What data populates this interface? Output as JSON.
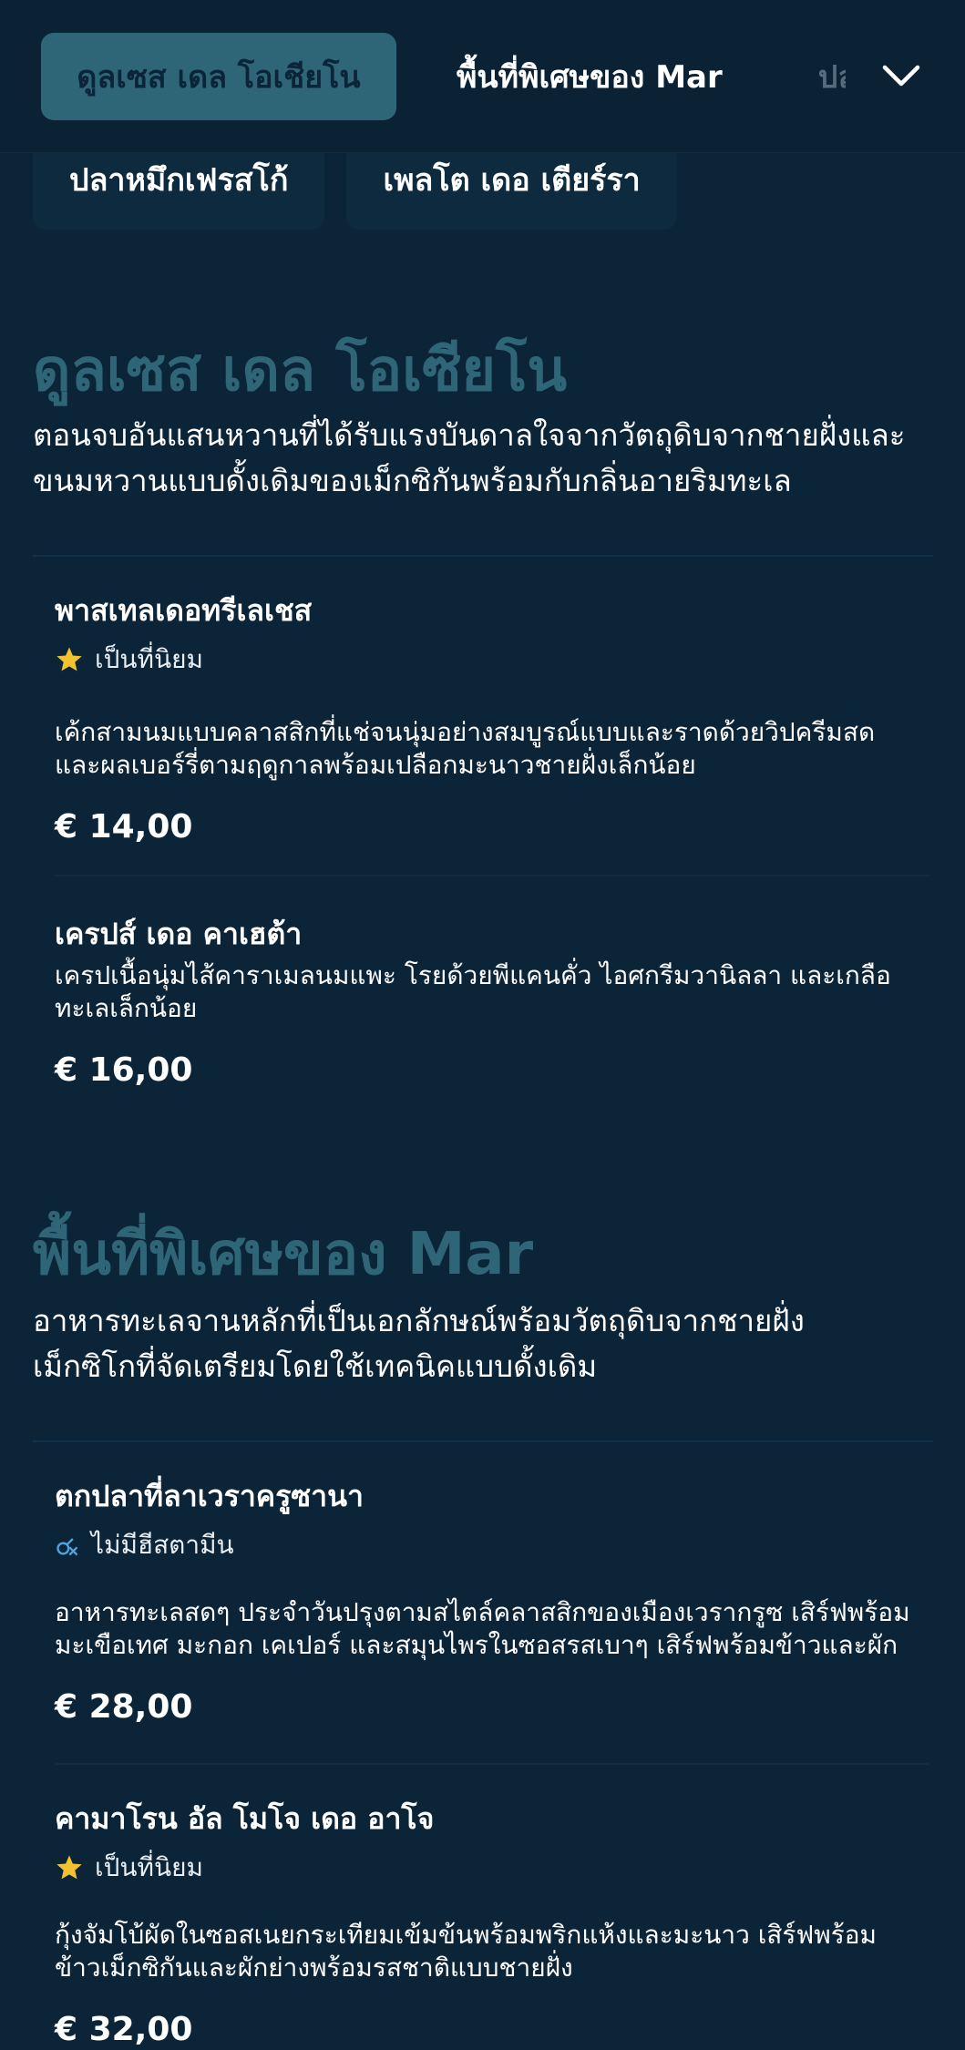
{
  "tabs": [
    {
      "label": "ดูลเซส เดล โอเชียโน",
      "active": true
    },
    {
      "label": "พื้นที่พิเศษของ Mar",
      "active": false
    },
    {
      "label": "ปล",
      "active": false
    }
  ],
  "subtabs": [
    {
      "label": "ปลาหมึกเฟรสโก้"
    },
    {
      "label": "เพลโต เดอ เตียร์รา"
    }
  ],
  "sections": [
    {
      "title": "ดูลเซส เดล โอเซียโน",
      "description": "ตอนจบอันแสนหวานที่ได้รับแรงบันดาลใจจากวัตถุดิบจากชายฝั่งและขนมหวานแบบดั้งเดิมของเม็กซิกันพร้อมกับกลิ่นอายริมทะเล",
      "items": [
        {
          "name": "พาสเทลเดอทรีเลเชส",
          "badge": "เป็นที่นิยม",
          "badge_icon": "star-icon",
          "description": "เค้กสามนมแบบคลาสสิกที่แช่จนนุ่มอย่างสมบูรณ์แบบและราดด้วยวิปครีมสดและผลเบอร์รี่ตามฤดูกาลพร้อมเปลือกมะนาวชายฝั่งเล็กน้อย",
          "price": "€ 14,00"
        },
        {
          "name": "เครปส์ เดอ คาเฮต้า",
          "badge": "",
          "description": "เครปเนื้อนุ่มไส้คาราเมลนมแพะ โรยด้วยพีแคนคั่ว ไอศกรีมวานิลลา และเกลือทะเลเล็กน้อย",
          "price": "€ 16,00"
        }
      ]
    },
    {
      "title": "พื้นที่พิเศษของ Mar",
      "description": "อาหารทะเลจานหลักที่เป็นเอกลักษณ์พร้อมวัตถุดิบจากชายฝั่งเม็กซิโกที่จัดเตรียมโดยใช้เทคนิคแบบดั้งเดิม",
      "items": [
        {
          "name": "ตกปลาที่ลาเวราครูซานา",
          "badge": "ไม่มีฮีสตามีน",
          "badge_icon": "histamine-free-icon",
          "description": "อาหารทะเลสดๆ ประจำวันปรุงตามสไตล์คลาสสิกของเมืองเวรากรูซ เสิร์ฟพร้อมมะเขือเทศ มะกอก เคเปอร์ และสมุนไพรในซอสรสเบาๆ เสิร์ฟพร้อมข้าวและผักตามฤดูกาล",
          "price": "€ 28,00"
        },
        {
          "name": "คามาโรน อัล โมโจ เดอ อาโจ",
          "badge": "เป็นที่นิยม",
          "badge_icon": "star-icon",
          "description": "กุ้งจัมโบ้ผัดในซอสเนยกระเทียมเข้มข้นพร้อมพริกแห้งและมะนาว เสิร์ฟพร้อมข้าวเม็กซิกันและผักย่างพร้อมรสชาติแบบชายฝั่ง",
          "price": "€ 32,00"
        }
      ]
    }
  ],
  "colors": {
    "background": "#0b2438",
    "accent": "#2f6677",
    "star": "#f2c230",
    "histamine_icon": "#4aa6e0"
  }
}
